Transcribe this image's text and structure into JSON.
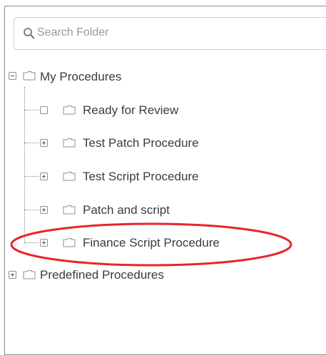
{
  "search": {
    "placeholder": "Search Folder",
    "icon": "search-icon"
  },
  "tree": {
    "root": {
      "label": "My Procedures",
      "expanded": true,
      "icon": "folder-icon"
    },
    "children": [
      {
        "label": "Ready for Review",
        "toggle": "empty"
      },
      {
        "label": "Test Patch Procedure",
        "toggle": "plus"
      },
      {
        "label": "Test Script Procedure",
        "toggle": "plus"
      },
      {
        "label": "Patch and script",
        "toggle": "plus"
      },
      {
        "label": "Finance Script Procedure",
        "toggle": "plus",
        "highlighted": true
      }
    ],
    "predefined": {
      "label": "Predefined Procedures",
      "toggle": "plus",
      "icon": "folder-icon"
    }
  },
  "colors": {
    "highlight": "#e8252b",
    "text": "#3c3c3c",
    "placeholder": "#9a9a9a"
  }
}
